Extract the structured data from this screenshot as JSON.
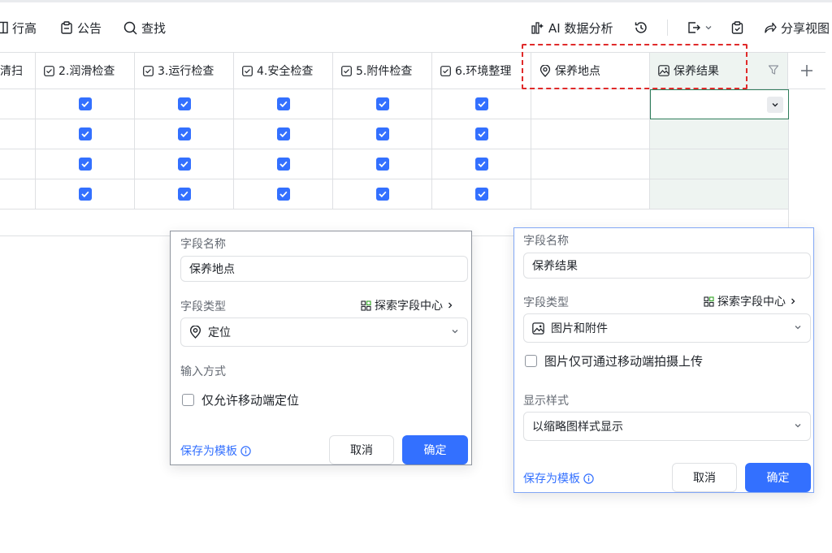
{
  "toolbar": {
    "row_height": "行高",
    "announcement": "公告",
    "find": "查找",
    "ai_analysis": "AI 数据分析",
    "share_view": "分享视图"
  },
  "columns": [
    {
      "label": "清扫",
      "icon": "checkbox-field-icon"
    },
    {
      "label": "2.润滑检查",
      "icon": "checkbox-field-icon"
    },
    {
      "label": "3.运行检查",
      "icon": "checkbox-field-icon"
    },
    {
      "label": "4.安全检查",
      "icon": "checkbox-field-icon"
    },
    {
      "label": "5.附件检查",
      "icon": "checkbox-field-icon"
    },
    {
      "label": "6.环境整理",
      "icon": "checkbox-field-icon"
    },
    {
      "label": "保养地点",
      "icon": "location-icon"
    },
    {
      "label": "保养结果",
      "icon": "image-icon"
    }
  ],
  "rows": [
    {
      "checks": [
        true,
        true,
        true,
        true,
        true
      ]
    },
    {
      "checks": [
        true,
        true,
        true,
        true,
        true
      ]
    },
    {
      "checks": [
        true,
        true,
        true,
        true,
        true
      ]
    },
    {
      "checks": [
        true,
        true,
        true,
        true,
        true
      ]
    }
  ],
  "panel_location": {
    "field_name_label": "字段名称",
    "field_name_value": "保养地点",
    "field_type_label": "字段类型",
    "explore_label": "探索字段中心",
    "field_type_value": "定位",
    "input_method_label": "输入方式",
    "mobile_only_label": "仅允许移动端定位",
    "save_template": "保存为模板",
    "cancel": "取消",
    "confirm": "确定"
  },
  "panel_result": {
    "field_name_label": "字段名称",
    "field_name_value": "保养结果",
    "field_type_label": "字段类型",
    "explore_label": "探索字段中心",
    "field_type_value": "图片和附件",
    "mobile_upload_label": "图片仅可通过移动端拍摄上传",
    "display_style_label": "显示样式",
    "display_style_value": "以缩略图样式显示",
    "save_template": "保存为模板",
    "cancel": "取消",
    "confirm": "确定"
  },
  "colors": {
    "accent": "#3370ff",
    "selected_column": "#eef4f1",
    "highlight_dash": "#e02a2a"
  }
}
